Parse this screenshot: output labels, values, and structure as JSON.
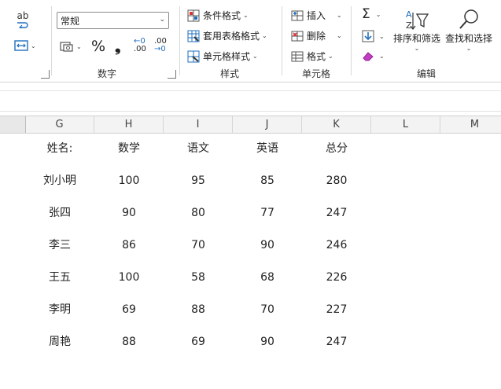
{
  "ribbon": {
    "spelling_text": "ab",
    "number_group": {
      "format_value": "常规",
      "percent_symbol": "%",
      "comma_symbol": "❟",
      "decrease_decimals": ".00",
      "increase_decimals": ".00",
      "label": "数字"
    },
    "styles_group": {
      "conditional_format": "条件格式",
      "table_format": "套用表格格式",
      "cell_style": "单元格样式",
      "label": "样式"
    },
    "cells_group": {
      "insert": "插入",
      "delete": "删除",
      "format": "格式",
      "label": "单元格"
    },
    "editing_group": {
      "sort_filter": "排序和筛选",
      "find_select": "查找和选择",
      "label": "编辑"
    }
  },
  "columns": [
    "G",
    "H",
    "I",
    "J",
    "K",
    "L",
    "M"
  ],
  "table": {
    "headers": [
      "姓名:",
      "数学",
      "语文",
      "英语",
      "总分"
    ],
    "rows": [
      [
        "刘小明",
        "100",
        "95",
        "85",
        "280"
      ],
      [
        "张四",
        "90",
        "80",
        "77",
        "247"
      ],
      [
        "李三",
        "86",
        "70",
        "90",
        "246"
      ],
      [
        "王五",
        "100",
        "58",
        "68",
        "226"
      ],
      [
        "李明",
        "69",
        "88",
        "70",
        "227"
      ],
      [
        "周艳",
        "88",
        "69",
        "90",
        "247"
      ]
    ]
  },
  "colors": {
    "accent": "#1f6fbf",
    "eraser": "#c43cc4",
    "header_bg": "#f3f3f3"
  }
}
